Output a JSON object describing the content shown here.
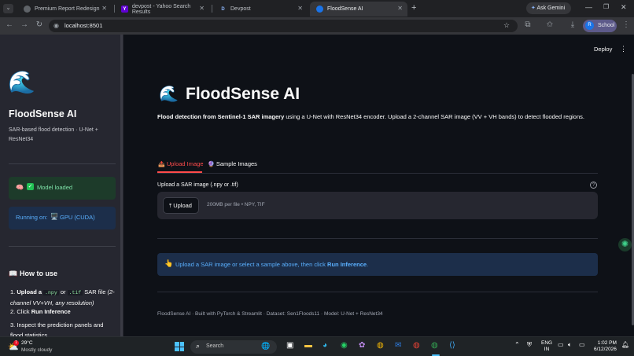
{
  "browser": {
    "tabs": [
      {
        "title": "Premium Report Redesign",
        "fav_color": "#5f6368",
        "fav": ""
      },
      {
        "title": "devpost - Yahoo Search Results",
        "fav_color": "#6001d2",
        "fav": "Y"
      },
      {
        "title": "Devpost",
        "fav_color": "#003e54",
        "fav": "D"
      },
      {
        "title": "FloodSense AI",
        "fav_color": "#1a73e8",
        "fav": ""
      }
    ],
    "ask_gemini": "Ask Gemini",
    "url": "localhost:8501",
    "profile_label": "School",
    "profile_initial": "R"
  },
  "header": {
    "deploy_label": "Deploy"
  },
  "sidebar": {
    "app_title": "FloodSense AI",
    "subtitle": "SAR-based flood detection · U-Net + ResNet34",
    "model_status": "Model loaded",
    "device_prefix": "Running on:",
    "device_value": "GPU (CUDA)",
    "how_to_title": "How to use",
    "steps": [
      {
        "num": "1.",
        "pre": "Upload a",
        "code1": ".npy",
        "mid": "or",
        "code2": ".tif",
        "post": "SAR file",
        "em": "(2-channel VV+VH, any resolution)"
      },
      {
        "num": "2.",
        "pre": "Click",
        "bold": "Run Inference"
      },
      {
        "num": "3.",
        "text": "Inspect the prediction panels and flood statistics"
      }
    ]
  },
  "main": {
    "title": "FloodSense AI",
    "intro_bold": "Flood detection from Sentinel-1 SAR imagery",
    "intro_rest": "using a U-Net with ResNet34 encoder. Upload a 2-channel SAR image (VV + VH bands) to detect flooded regions.",
    "tabs": [
      {
        "label": "Upload Image",
        "icon": "📤",
        "active": true
      },
      {
        "label": "Sample Images",
        "icon": "🔮",
        "active": false
      }
    ],
    "uploader_label": "Upload a SAR image (.npy or .tif)",
    "upload_button": "Upload",
    "upload_hint": "200MB per file • NPY, TIF",
    "info_text": "Upload a SAR image or select a sample above, then click",
    "info_bold": "Run Inference",
    "info_end": ".",
    "footer": "FloodSense AI · Built with PyTorch & Streamlit · Dataset: Sen1Floods11 · Model: U-Net + ResNet34"
  },
  "taskbar": {
    "weather_temp": "29°C",
    "weather_desc": "Mostly cloudy",
    "weather_badge": "1",
    "search_placeholder": "Search",
    "lang_top": "ENG",
    "lang_bottom": "IN",
    "time": "1:02 PM",
    "date": "6/12/2026"
  },
  "colors": {
    "accent_red": "#ff4b4b",
    "success_bg": "#1d3b2a",
    "success_text": "#7ee2a8",
    "info_bg": "#1c2e4a",
    "info_text": "#5ab0ff"
  }
}
